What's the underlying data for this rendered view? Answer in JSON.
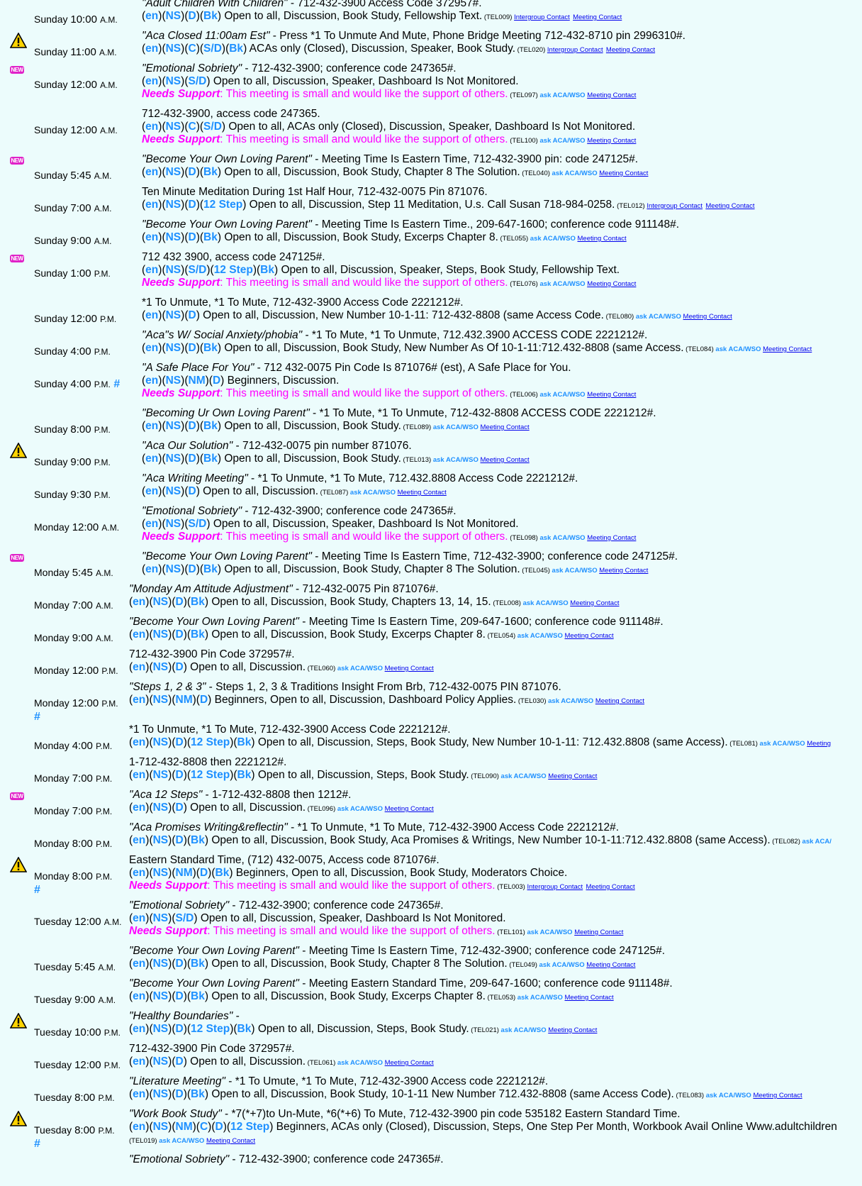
{
  "legend": {
    "new_badge": "NEW",
    "hash": "#"
  },
  "meetings": [
    {
      "icon": "",
      "day": "Sunday",
      "time": "10:00",
      "ampm": "A.M.",
      "hash": "",
      "name": "\"Adult Children With Children\"",
      "info": " - 712-432-3900 Access Code 372957#.",
      "codes": [
        "en",
        "NS",
        "D",
        "Bk"
      ],
      "desc": " Open to all, Discussion, Book Study, Fellowship Text.",
      "support": false,
      "tel": "(TEL009)",
      "ask": "",
      "links": [
        "Intergroup Contact",
        "Meeting Contact"
      ]
    },
    {
      "icon": "warning",
      "day": "Sunday",
      "time": "11:00",
      "ampm": "A.M.",
      "hash": "",
      "name": "\"Aca Closed 11:00am Est\"",
      "info": " - Press *1 To Unmute And Mute, Phone Bridge Meeting 712-432-8710 pin 2996310#.",
      "codes": [
        "en",
        "NS",
        "C",
        "S/D",
        "Bk"
      ],
      "desc": " ACAs only (Closed), Discussion, Speaker, Book Study.",
      "support": false,
      "tel": "(TEL020)",
      "ask": "",
      "links": [
        "Intergroup Contact",
        "Meeting Contact"
      ]
    },
    {
      "icon": "new",
      "day": "Sunday",
      "time": "12:00",
      "ampm": "A.M.",
      "hash": "",
      "name": "\"Emotional Sobriety\"",
      "info": " - 712-432-3900; conference code 247365#.",
      "codes": [
        "en",
        "NS",
        "S/D"
      ],
      "desc": " Open to all, Discussion, Speaker, Dashboard Is Not Monitored.",
      "support": true,
      "tel": "(TEL097)",
      "ask": "ask ACA/WSO",
      "links": [
        "Meeting Contact"
      ]
    },
    {
      "icon": "",
      "day": "Sunday",
      "time": "12:00",
      "ampm": "A.M.",
      "hash": "",
      "name": "",
      "info": "712-432-3900, access code 247365.",
      "codes": [
        "en",
        "NS",
        "C",
        "S/D"
      ],
      "desc": " Open to all, ACAs only (Closed), Discussion, Speaker, Dashboard Is Not Monitored.",
      "support": true,
      "tel": "(TEL100)",
      "ask": "ask ACA/WSO",
      "links": [
        "Meeting Contact"
      ]
    },
    {
      "icon": "new",
      "day": "Sunday",
      "time": "5:45",
      "ampm": "A.M.",
      "hash": "",
      "name": "\"Become Your Own Loving Parent\"",
      "info": " - Meeting Time Is Eastern Time, 712-432-3900 pin: code 247125#.",
      "codes": [
        "en",
        "NS",
        "D",
        "Bk"
      ],
      "desc": " Open to all, Discussion, Book Study, Chapter 8 The Solution.",
      "support": false,
      "tel": "(TEL040)",
      "ask": "ask ACA/WSO",
      "links": [
        "Meeting Contact"
      ]
    },
    {
      "icon": "",
      "day": "Sunday",
      "time": "7:00",
      "ampm": "A.M.",
      "hash": "",
      "name": "",
      "info": "Ten Minute Meditation During 1st Half Hour, 712-432-0075 Pin 871076.",
      "codes": [
        "en",
        "NS",
        "D",
        "12 Step"
      ],
      "desc": " Open to all, Discussion, Step 11 Meditation, U.s. Call Susan 718-984-0258.",
      "support": false,
      "tel": "(TEL012)",
      "ask": "",
      "links": [
        "Intergroup Contact",
        "Meeting Contact"
      ]
    },
    {
      "icon": "",
      "day": "Sunday",
      "time": "9:00",
      "ampm": "A.M.",
      "hash": "",
      "name": "\"Become Your Own Loving Parent\"",
      "info": " - Meeting Time Is Eastern Time., 209-647-1600; conference code 911148#.",
      "codes": [
        "en",
        "NS",
        "D",
        "Bk"
      ],
      "desc": " Open to all, Discussion, Book Study, Excerps Chapter 8.",
      "support": false,
      "tel": "(TEL055)",
      "ask": "ask ACA/WSO",
      "links": [
        "Meeting Contact"
      ]
    },
    {
      "icon": "new",
      "day": "Sunday",
      "time": "1:00",
      "ampm": "P.M.",
      "hash": "",
      "name": "",
      "info": "712 432 3900, access code 247125#.",
      "codes": [
        "en",
        "NS",
        "S/D",
        "12 Step",
        "Bk"
      ],
      "desc": " Open to all, Discussion, Speaker, Steps, Book Study, Fellowship Text.",
      "support": true,
      "tel": "(TEL076)",
      "ask": "ask ACA/WSO",
      "links": [
        "Meeting Contact"
      ]
    },
    {
      "icon": "",
      "day": "Sunday",
      "time": "12:00",
      "ampm": "P.M.",
      "hash": "",
      "name": "",
      "info": "*1 To Unmute, *1 To Mute, 712-432-3900 Access Code 2221212#.",
      "codes": [
        "en",
        "NS",
        "D"
      ],
      "desc": " Open to all, Discussion, New Number 10-1-11: 712-432-8808 (same Access Code.",
      "support": false,
      "tel": "(TEL080)",
      "ask": "ask ACA/WSO",
      "links": [
        "Meeting Contact"
      ]
    },
    {
      "icon": "",
      "day": "Sunday",
      "time": "4:00",
      "ampm": "P.M.",
      "hash": "",
      "name": "\"Aca\"s W/ Social Anxiety/phobia\"",
      "info": " - *1 To Mute, *1 To Unmute, 712.432.3900 ACCESS CODE 2221212#.",
      "codes": [
        "en",
        "NS",
        "D",
        "Bk"
      ],
      "desc": " Open to all, Discussion, Book Study, New Number As Of 10-1-11:712.432-8808 (same Access.",
      "support": false,
      "tel": "(TEL084)",
      "ask": "ask ACA/WSO",
      "links": [
        "Meeting Contact"
      ]
    },
    {
      "icon": "",
      "day": "Sunday",
      "time": "4:00",
      "ampm": "P.M.",
      "hash": "#",
      "name": "\"A Safe Place For You\"",
      "info": " - 712 432-0075 Pin Code Is 871076# (est), A Safe Place for You.",
      "codes": [
        "en",
        "NS",
        "NM",
        "D"
      ],
      "desc": " Beginners, Discussion.",
      "support": true,
      "tel": "(TEL006)",
      "ask": "ask ACA/WSO",
      "links": [
        "Meeting Contact"
      ]
    },
    {
      "icon": "",
      "day": "Sunday",
      "time": "8:00",
      "ampm": "P.M.",
      "hash": "",
      "name": "\"Becoming Ur Own Loving Parent\"",
      "info": " - *1 To Mute, *1 To Unmute, 712-432-8808 ACCESS CODE 2221212#.",
      "codes": [
        "en",
        "NS",
        "D",
        "Bk"
      ],
      "desc": " Open to all, Discussion, Book Study.",
      "support": false,
      "tel": "(TEL089)",
      "ask": "ask ACA/WSO",
      "links": [
        "Meeting Contact"
      ]
    },
    {
      "icon": "warning",
      "day": "Sunday",
      "time": "9:00",
      "ampm": "P.M.",
      "hash": "",
      "name": "\"Aca Our Solution\"",
      "info": " - 712-432-0075 pin number 871076.",
      "codes": [
        "en",
        "NS",
        "D",
        "Bk"
      ],
      "desc": " Open to all, Discussion, Book Study.",
      "support": false,
      "tel": "(TEL013)",
      "ask": "ask ACA/WSO",
      "links": [
        "Meeting Contact"
      ]
    },
    {
      "icon": "",
      "day": "Sunday",
      "time": "9:30",
      "ampm": "P.M.",
      "hash": "",
      "name": "\"Aca Writing Meeting\"",
      "info": " - *1 To Unmute, *1 To Mute, 712.432.8808 Access Code 2221212#.",
      "codes": [
        "en",
        "NS",
        "D"
      ],
      "desc": " Open to all, Discussion.",
      "support": false,
      "tel": "(TEL087)",
      "ask": "ask ACA/WSO",
      "links": [
        "Meeting Contact"
      ]
    },
    {
      "icon": "",
      "day": "Monday",
      "time": "12:00",
      "ampm": "A.M.",
      "hash": "",
      "name": "\"Emotional Sobriety\"",
      "info": " - 712-432-3900; conference code 247365#.",
      "codes": [
        "en",
        "NS",
        "S/D"
      ],
      "desc": " Open to all, Discussion, Speaker, Dashboard Is Not Monitored.",
      "support": true,
      "tel": "(TEL098)",
      "ask": "ask ACA/WSO",
      "links": [
        "Meeting Contact"
      ]
    },
    {
      "icon": "new",
      "day": "Monday",
      "time": "5:45",
      "ampm": "A.M.",
      "hash": "",
      "name": "\"Become Your Own Loving Parent\"",
      "info": " - Meeting Time Is Eastern Time, 712-432-3900; conference code 247125#.",
      "codes": [
        "en",
        "NS",
        "D",
        "Bk"
      ],
      "desc": " Open to all, Discussion, Book Study, Chapter 8 The Solution.",
      "support": false,
      "tel": "(TEL045)",
      "ask": "ask ACA/WSO",
      "links": [
        "Meeting Contact"
      ]
    },
    {
      "icon": "",
      "day": "Monday",
      "time": "7:00",
      "ampm": "A.M.",
      "hash": "",
      "wide": true,
      "name": "\"Monday Am Attitude Adjustment\"",
      "info": " - 712-432-0075 Pin 871076#.",
      "codes": [
        "en",
        "NS",
        "D",
        "Bk"
      ],
      "desc": " Open to all, Discussion, Book Study, Chapters 13, 14, 15.",
      "support": false,
      "tel": "(TEL008)",
      "ask": "ask ACA/WSO",
      "links": [
        "Meeting Contact"
      ]
    },
    {
      "icon": "",
      "day": "Monday",
      "time": "9:00",
      "ampm": "A.M.",
      "hash": "",
      "wide": true,
      "name": "\"Become Your Own Loving Parent\"",
      "info": " - Meeting Time Is Eastern Time, 209-647-1600; conference code 911148#.",
      "codes": [
        "en",
        "NS",
        "D",
        "Bk"
      ],
      "desc": " Open to all, Discussion, Book Study, Excerps Chapter 8.",
      "support": false,
      "tel": "(TEL054)",
      "ask": "ask ACA/WSO",
      "links": [
        "Meeting Contact"
      ]
    },
    {
      "icon": "",
      "day": "Monday",
      "time": "12:00",
      "ampm": "P.M.",
      "hash": "",
      "wide": true,
      "name": "",
      "info": "712-432-3900 Pin Code 372957#.",
      "codes": [
        "en",
        "NS",
        "D"
      ],
      "desc": " Open to all, Discussion.",
      "support": false,
      "tel": "(TEL060)",
      "ask": "ask ACA/WSO",
      "links": [
        "Meeting Contact"
      ]
    },
    {
      "icon": "",
      "day": "Monday",
      "time": "12:00",
      "ampm": "P.M.",
      "hash": "#",
      "wide": true,
      "name": "\"Steps 1, 2 & 3\"",
      "info": " - Steps 1, 2, 3 & Traditions Insight From Brb, 712-432-0075 PIN 871076.",
      "codes": [
        "en",
        "NS",
        "NM",
        "D"
      ],
      "desc": " Beginners, Open to all, Discussion, Dashboard Policy Applies.",
      "support": false,
      "tel": "(TEL030)",
      "ask": "ask ACA/WSO",
      "links": [
        "Meeting Contact"
      ]
    },
    {
      "icon": "",
      "day": "Monday",
      "time": "4:00",
      "ampm": "P.M.",
      "hash": "",
      "wide": true,
      "name": "",
      "info": "*1 To Unmute, *1 To Mute, 712-432-3900 Access Code 2221212#.",
      "codes": [
        "en",
        "NS",
        "D",
        "12 Step",
        "Bk"
      ],
      "desc": " Open to all, Discussion, Steps, Book Study, New Number 10-1-11: 712.432.8808 (same Access).",
      "support": false,
      "tel": "(TEL081)",
      "ask": "ask ACA/WSO",
      "links": [
        "Meeting"
      ]
    },
    {
      "icon": "",
      "day": "Monday",
      "time": "7:00",
      "ampm": "P.M.",
      "hash": "",
      "wide": true,
      "name": "",
      "info": "1-712-432-8808 then 2221212#.",
      "codes": [
        "en",
        "NS",
        "D",
        "12 Step",
        "Bk"
      ],
      "desc": " Open to all, Discussion, Steps, Book Study.",
      "support": false,
      "tel": "(TEL090)",
      "ask": "ask ACA/WSO",
      "links": [
        "Meeting Contact"
      ]
    },
    {
      "icon": "new",
      "day": "Monday",
      "time": "7:00",
      "ampm": "P.M.",
      "hash": "",
      "wide": true,
      "name": "\"Aca 12 Steps\"",
      "info": " - 1-712-432-8808 then 1212#.",
      "codes": [
        "en",
        "NS",
        "D"
      ],
      "desc": " Open to all, Discussion.",
      "support": false,
      "tel": "(TEL096)",
      "ask": "ask ACA/WSO",
      "links": [
        "Meeting Contact"
      ]
    },
    {
      "icon": "",
      "day": "Monday",
      "time": "8:00",
      "ampm": "P.M.",
      "hash": "",
      "wide": true,
      "name": "\"Aca Promises Writing&reflectin\"",
      "info": " - *1 To Unmute, *1 To Mute, 712-432-3900 Access Code 2221212#.",
      "codes": [
        "en",
        "NS",
        "D",
        "Bk"
      ],
      "desc": " Open to all, Discussion, Book Study, Aca Promises & Writings, New Number 10-1-11:712.432.8808 (same Access).",
      "support": false,
      "tel": "(TEL082)",
      "ask": "ask ACA/",
      "links": []
    },
    {
      "icon": "warning",
      "day": "Monday",
      "time": "8:00",
      "ampm": "P.M.",
      "hash": "#",
      "wide": true,
      "name": "",
      "info": "Eastern Standard Time, (712) 432-0075, Access code 871076#.",
      "codes": [
        "en",
        "NS",
        "NM",
        "D",
        "Bk"
      ],
      "desc": " Beginners, Open to all, Discussion, Book Study, Moderators Choice.",
      "support": true,
      "tel": "(TEL003)",
      "ask": "",
      "links": [
        "Intergroup Contact",
        "Meeting Contact"
      ]
    },
    {
      "icon": "",
      "day": "Tuesday",
      "time": "12:00",
      "ampm": "A.M.",
      "hash": "",
      "wide": true,
      "name": "\"Emotional Sobriety\"",
      "info": " - 712-432-3900; conference code 247365#.",
      "codes": [
        "en",
        "NS",
        "S/D"
      ],
      "desc": " Open to all, Discussion, Speaker, Dashboard Is Not Monitored.",
      "support": true,
      "tel": "(TEL101)",
      "ask": "ask ACA/WSO",
      "links": [
        "Meeting Contact"
      ]
    },
    {
      "icon": "",
      "day": "Tuesday",
      "time": "5:45",
      "ampm": "A.M.",
      "hash": "",
      "wide": true,
      "name": "\"Become Your Own Loving Parent\"",
      "info": " - Meeting Time Is Eastern Time, 712-432-3900; conference code 247125#.",
      "codes": [
        "en",
        "NS",
        "D",
        "Bk"
      ],
      "desc": " Open to all, Discussion, Book Study, Chapter 8 The Solution.",
      "support": false,
      "tel": "(TEL049)",
      "ask": "ask ACA/WSO",
      "links": [
        "Meeting Contact"
      ]
    },
    {
      "icon": "",
      "day": "Tuesday",
      "time": "9:00",
      "ampm": "A.M.",
      "hash": "",
      "wide": true,
      "name": "\"Become Your Own Loving Parent\"",
      "info": " - Meeting Eastern Standard Time, 209-647-1600; conference code 911148#.",
      "codes": [
        "en",
        "NS",
        "D",
        "Bk"
      ],
      "desc": " Open to all, Discussion, Book Study, Excerps Chapter 8.",
      "support": false,
      "tel": "(TEL053)",
      "ask": "ask ACA/WSO",
      "links": [
        "Meeting Contact"
      ]
    },
    {
      "icon": "warning",
      "day": "Tuesday",
      "time": "10:00",
      "ampm": "P.M.",
      "hash": "",
      "wide": true,
      "name": "\"Healthy Boundaries\"",
      "info": " -",
      "codes": [
        "en",
        "NS",
        "D",
        "12 Step",
        "Bk"
      ],
      "desc": " Open to all, Discussion, Steps, Book Study.",
      "support": false,
      "tel": "(TEL021)",
      "ask": "ask ACA/WSO",
      "links": [
        "Meeting Contact"
      ]
    },
    {
      "icon": "",
      "day": "Tuesday",
      "time": "12:00",
      "ampm": "P.M.",
      "hash": "",
      "wide": true,
      "name": "",
      "info": "712-432-3900 Pin Code 372957#.",
      "codes": [
        "en",
        "NS",
        "D"
      ],
      "desc": " Open to all, Discussion.",
      "support": false,
      "tel": "(TEL061)",
      "ask": "ask ACA/WSO",
      "links": [
        "Meeting Contact"
      ]
    },
    {
      "icon": "",
      "day": "Tuesday",
      "time": "8:00",
      "ampm": "P.M.",
      "hash": "",
      "wide": true,
      "name": "\"Literature Meeting\"",
      "info": " - *1 To Umute, *1 To Mute, 712-432-3900 Access code 2221212#.",
      "codes": [
        "en",
        "NS",
        "D",
        "Bk"
      ],
      "desc": " Open to all, Discussion, Book Study, 10-1-11 New Number 712.432-8808 (same Access Code).",
      "support": false,
      "tel": "(TEL083)",
      "ask": "ask ACA/WSO",
      "links": [
        "Meeting Contact"
      ]
    },
    {
      "icon": "warning",
      "day": "Tuesday",
      "time": "8:00",
      "ampm": "P.M.",
      "hash": "#",
      "wide": true,
      "name": "\"Work Book Study\"",
      "info": " - *7(*+7)to Un-Mute, *6(*+6) To Mute, 712-432-3900 pin code 535182 Eastern Standard Time.",
      "codes": [
        "en",
        "NS",
        "NM",
        "C",
        "D",
        "12 Step"
      ],
      "desc": " Beginners, ACAs only (Closed), Discussion, Steps, One Step Per Month, Workbook Avail Online Www.adultchildren",
      "support": false,
      "tel": "",
      "ask": "",
      "links": [],
      "extra_tel": "(TEL019)",
      "extra_ask": "ask ACA/WSO",
      "extra_link": "Meeting Contact"
    },
    {
      "icon": "",
      "day": "",
      "time": "",
      "ampm": "",
      "hash": "",
      "wide": true,
      "name": "\"Emotional Sobriety\"",
      "info": " - 712-432-3900; conference code 247365#.",
      "codes": [],
      "desc": "",
      "support": false,
      "tel": "",
      "ask": "",
      "links": []
    }
  ],
  "support_label": "Needs Support",
  "support_text": ": This meeting is small and would like the support of others."
}
